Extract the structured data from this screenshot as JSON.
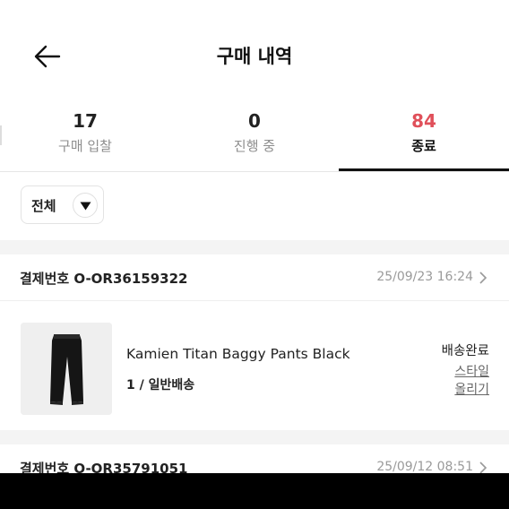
{
  "header": {
    "title": "구매 내역",
    "back_icon": "arrow-left-icon"
  },
  "tabs": [
    {
      "count": "17",
      "label": "구매 입찰",
      "active": false
    },
    {
      "count": "0",
      "label": "진행 중",
      "active": false
    },
    {
      "count": "84",
      "label": "종료",
      "active": true
    }
  ],
  "colors": {
    "accent": "#e0505a",
    "indicator": "#111111"
  },
  "filter": {
    "label": "전체",
    "icon": "caret-down-icon"
  },
  "orders": [
    {
      "number_label": "결제번호 O-OR36159322",
      "date": "25/09/23 16:24",
      "product": {
        "name": "Kamien Titan Baggy Pants Black",
        "option": "1 / 일반배송",
        "status": "배송완료",
        "style_link_line1": "스타일",
        "style_link_line2": "올리기"
      }
    },
    {
      "number_label": "결제번호 O-OR35791051",
      "date": "25/09/12 08:51"
    }
  ]
}
